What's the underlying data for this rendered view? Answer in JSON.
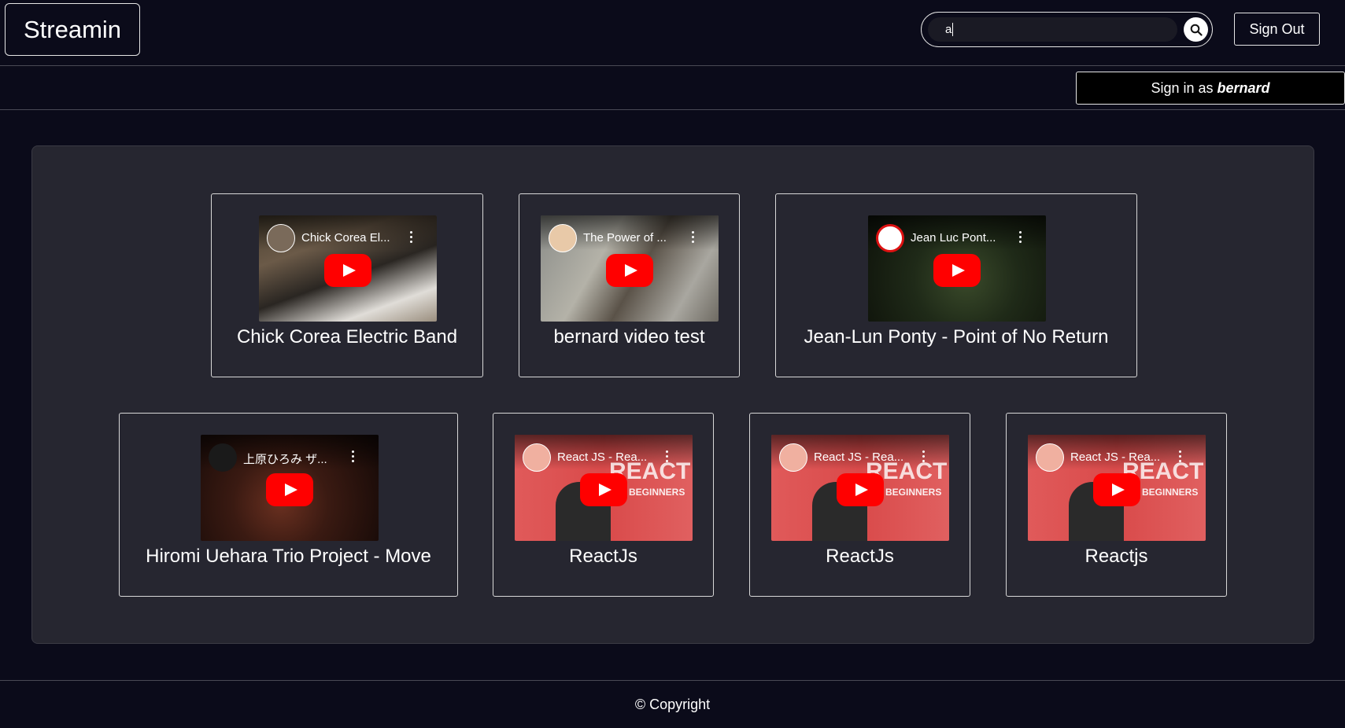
{
  "header": {
    "brand": "Streamin",
    "search_value": "a",
    "sign_out_label": "Sign Out"
  },
  "subbar": {
    "sign_in_prefix": "Sign in as",
    "username": "bernard"
  },
  "videos": [
    {
      "title": "Chick Corea Electric Band",
      "embed_title": "Chick Corea El..."
    },
    {
      "title": "bernard video test",
      "embed_title": "The Power of ..."
    },
    {
      "title": "Jean-Lun Ponty - Point of No Return",
      "embed_title": "Jean Luc Pont..."
    },
    {
      "title": "Hiromi Uehara Trio Project - Move",
      "embed_title": "上原ひろみ ザ..."
    },
    {
      "title": "ReactJs",
      "embed_title": "React JS - Rea..."
    },
    {
      "title": "ReactJs",
      "embed_title": "React JS - Rea..."
    },
    {
      "title": "Reactjs",
      "embed_title": "React JS - Rea..."
    }
  ],
  "thumb_text": {
    "react_overlay": "REACT",
    "react_sub": "BEGINNERS"
  },
  "footer": {
    "copyright": "© Copyright"
  },
  "colors": {
    "background": "#0b0b1a",
    "panel": "#262630",
    "play_button": "#ff0000"
  }
}
